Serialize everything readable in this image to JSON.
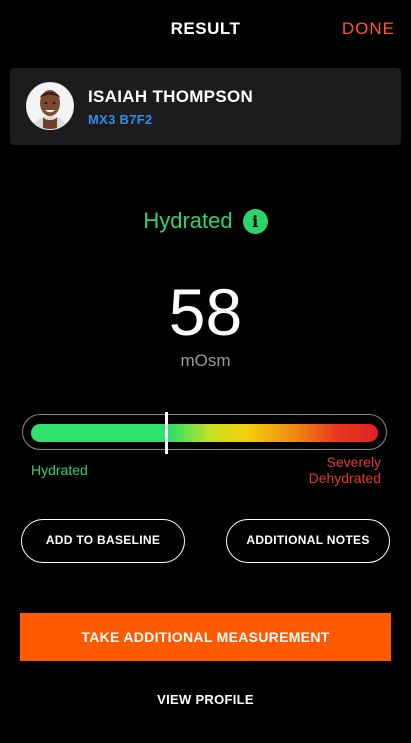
{
  "header": {
    "title": "RESULT",
    "done_label": "DONE"
  },
  "profile": {
    "name": "ISAIAH THOMPSON",
    "device_id": "MX3 B7F2",
    "avatar_icon": "person-photo-avatar"
  },
  "result": {
    "status": "Hydrated",
    "info_icon": "info-icon",
    "info_glyph": "i",
    "value": "58",
    "unit": "mOsm"
  },
  "gauge": {
    "level": 0.39,
    "left_label": "Hydrated",
    "right_label_line1": "Severely",
    "right_label_line2": "Dehydrated"
  },
  "actions": {
    "add_baseline": "ADD TO BASELINE",
    "additional_notes": "ADDITIONAL NOTES",
    "take_measurement": "TAKE ADDITIONAL MEASUREMENT",
    "view_profile": "VIEW PROFILE"
  },
  "colors": {
    "accent": "#ff5a00",
    "hydrated_green": "#2ed36a",
    "dehydrated_red": "#e83a2a",
    "device_blue": "#2e8fe6",
    "background": "#000000",
    "card": "#1c1c1e"
  }
}
